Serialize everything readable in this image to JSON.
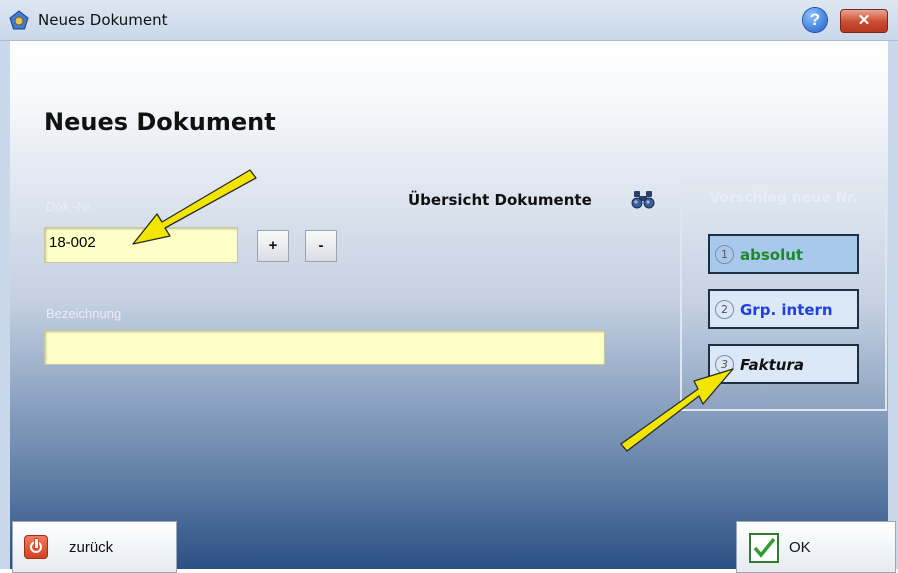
{
  "window": {
    "title": "Neues Dokument",
    "help_label": "?",
    "close_label": "✕"
  },
  "heading": "Neues Dokument",
  "doc_nr": {
    "label": "Dok.-Nr.",
    "value": "18-002",
    "plus": "+",
    "minus": "-"
  },
  "bezeichnung": {
    "label": "Bezeichnung",
    "value": ""
  },
  "overview": {
    "label": "Übersicht Dokumente",
    "icon": "binoculars-icon"
  },
  "vorschlag": {
    "title": "Vorschlag neue Nr.",
    "options": [
      {
        "num": "1",
        "label": "absolut",
        "color": "#1f8a2c",
        "bg": "#a9c9ec",
        "italic": false
      },
      {
        "num": "2",
        "label": "Grp. intern",
        "color": "#1f3fe0",
        "bg": "#dbe8f8",
        "italic": false
      },
      {
        "num": "3",
        "label": "Faktura",
        "color": "#111111",
        "bg": "#dbe8f8",
        "italic": true
      }
    ]
  },
  "buttons": {
    "back": "zurück",
    "ok": "OK"
  },
  "colors": {
    "field_bg": "#ffffc8",
    "arrow": "#f2e600"
  }
}
